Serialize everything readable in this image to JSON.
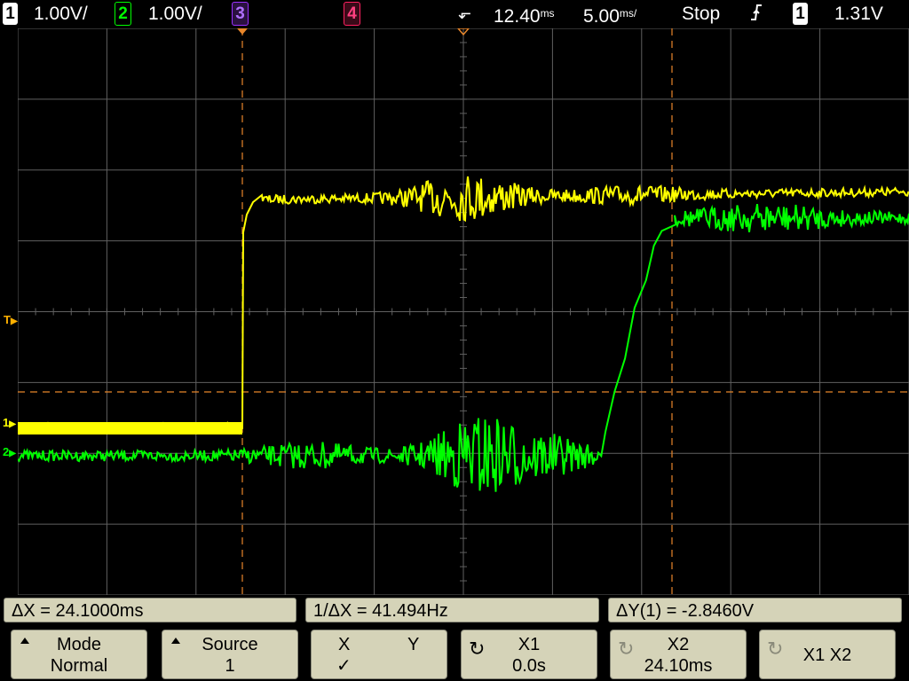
{
  "topbar": {
    "ch1": {
      "num": "1",
      "scale": "1.00V/",
      "color": "#ffff00"
    },
    "ch2": {
      "num": "2",
      "scale": "1.00V/",
      "color": "#00ff00"
    },
    "ch3": {
      "num": "3",
      "color": "#9b30ff"
    },
    "ch4": {
      "num": "4",
      "color": "#ff2060"
    },
    "delay_prefix": "12.40",
    "delay_unit": "ms",
    "timebase_prefix": "5.00",
    "timebase_unit": "ms/",
    "run_state": "Stop",
    "trigger_slope": "rising",
    "trigger_source": "1",
    "trigger_level": "1.31V"
  },
  "markers": {
    "trigger_level": "T",
    "ch1_ground": "1",
    "ch2_ground": "2"
  },
  "colors": {
    "grid": "#606060",
    "cursor": "#e8862a",
    "ch1_trace": "#ffff00",
    "ch2_trace": "#00ff00",
    "panel": "#d5d3b8"
  },
  "measurements": {
    "delta_x": "ΔX = 24.1000ms",
    "inv_delta_x": "1/ΔX = 41.494Hz",
    "delta_y": "ΔY(1) = -2.8460V"
  },
  "softkeys": {
    "mode_title": "Mode",
    "mode_value": "Normal",
    "source_title": "Source",
    "source_value": "1",
    "x_label": "X",
    "y_label": "Y",
    "xy_selected": "✓",
    "x1_title": "X1",
    "x1_value": "0.0s",
    "x2_title": "X2",
    "x2_value": "24.10ms",
    "x1x2_label": "X1 X2"
  }
}
